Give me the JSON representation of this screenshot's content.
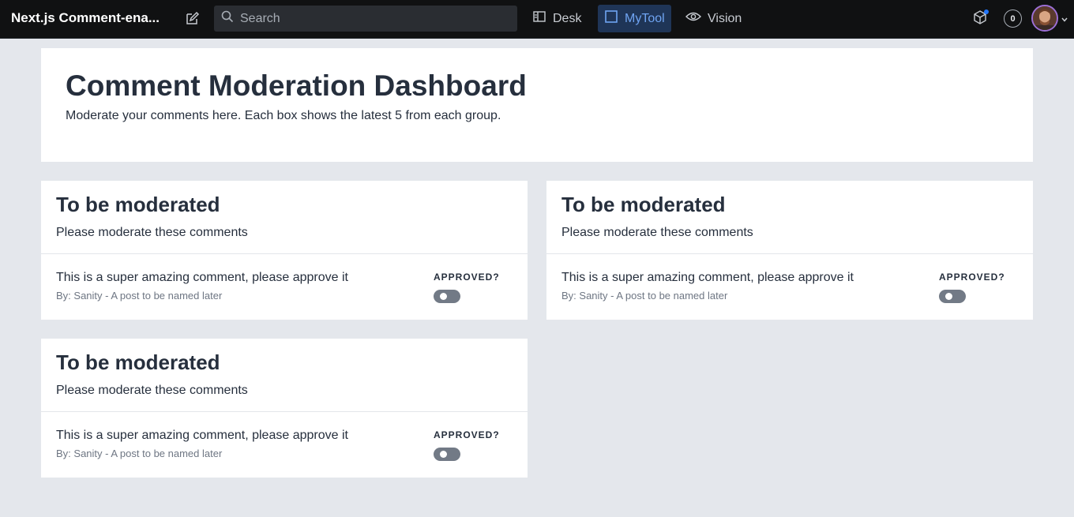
{
  "topbar": {
    "app_title": "Next.js Comment-ena...",
    "search_placeholder": "Search",
    "tabs": [
      {
        "label": "Desk",
        "icon": "desk-icon",
        "active": false
      },
      {
        "label": "MyTool",
        "icon": "square-icon",
        "active": true
      },
      {
        "label": "Vision",
        "icon": "eye-icon",
        "active": false
      }
    ],
    "notification_count": "0",
    "colors": {
      "bar": "#101112",
      "active_tab_bg": "#1f3557",
      "active_tab_text": "#6fa4f2",
      "status_dot": "#2276fc"
    }
  },
  "dashboard": {
    "title": "Comment Moderation Dashboard",
    "description": "Moderate your comments here. Each box shows the latest 5 from each group."
  },
  "groups": [
    {
      "title": "To be moderated",
      "subtitle": "Please moderate these comments",
      "comment": {
        "text": "This is a super amazing comment, please approve it",
        "meta": "By: Sanity - A post to be named later",
        "approved_label": "APPROVED?",
        "approved": false
      }
    },
    {
      "title": "To be moderated",
      "subtitle": "Please moderate these comments",
      "comment": {
        "text": "This is a super amazing comment, please approve it",
        "meta": "By: Sanity - A post to be named later",
        "approved_label": "APPROVED?",
        "approved": false
      }
    },
    {
      "title": "To be moderated",
      "subtitle": "Please moderate these comments",
      "comment": {
        "text": "This is a super amazing comment, please approve it",
        "meta": "By: Sanity - A post to be named later",
        "approved_label": "APPROVED?",
        "approved": false
      }
    }
  ]
}
